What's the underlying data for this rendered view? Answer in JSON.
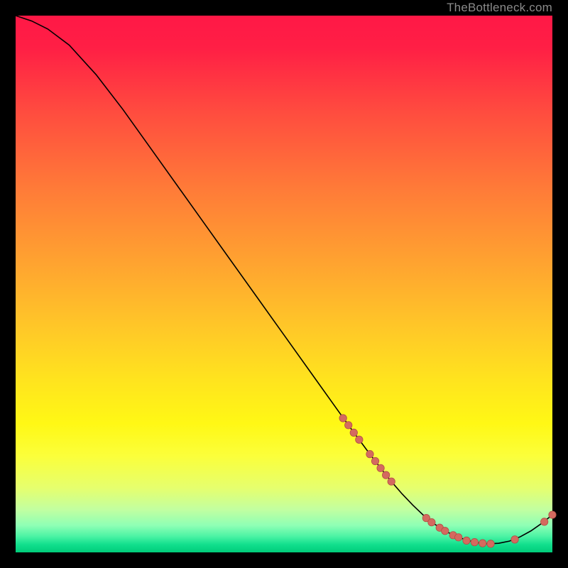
{
  "watermark": "TheBottleneck.com",
  "colors": {
    "curve_stroke": "#000000",
    "marker_fill": "#d46a5f",
    "marker_stroke": "#b24f45"
  },
  "chart_data": {
    "type": "line",
    "title": "",
    "xlabel": "",
    "ylabel": "",
    "xlim": [
      0,
      100
    ],
    "ylim": [
      0,
      100
    ],
    "grid": false,
    "legend": null,
    "series": [
      {
        "name": "curve",
        "x": [
          0,
          3,
          6,
          10,
          15,
          20,
          25,
          30,
          35,
          40,
          45,
          50,
          55,
          60,
          62,
          64,
          66,
          68,
          70,
          72,
          74,
          76,
          78,
          80,
          82,
          84,
          86,
          88,
          90,
          92,
          94,
          96,
          98,
          100
        ],
        "y": [
          100,
          99,
          97.5,
          94.5,
          89,
          82.5,
          75.5,
          68.5,
          61.5,
          54.5,
          47.5,
          40.5,
          33.5,
          26.5,
          23.7,
          21.0,
          18.3,
          15.7,
          13.2,
          10.9,
          8.8,
          6.9,
          5.3,
          4.0,
          3.0,
          2.3,
          1.8,
          1.6,
          1.7,
          2.1,
          2.9,
          4.0,
          5.4,
          7.0
        ]
      }
    ],
    "markers": [
      {
        "x": 61.0,
        "y": 25.0
      },
      {
        "x": 62.0,
        "y": 23.7
      },
      {
        "x": 63.0,
        "y": 22.3
      },
      {
        "x": 64.0,
        "y": 21.0
      },
      {
        "x": 66.0,
        "y": 18.3
      },
      {
        "x": 67.0,
        "y": 17.0
      },
      {
        "x": 68.0,
        "y": 15.7
      },
      {
        "x": 69.0,
        "y": 14.4
      },
      {
        "x": 70.0,
        "y": 13.2
      },
      {
        "x": 76.5,
        "y": 6.4
      },
      {
        "x": 77.5,
        "y": 5.6
      },
      {
        "x": 79.0,
        "y": 4.6
      },
      {
        "x": 80.0,
        "y": 4.0
      },
      {
        "x": 81.5,
        "y": 3.2
      },
      {
        "x": 82.5,
        "y": 2.8
      },
      {
        "x": 84.0,
        "y": 2.2
      },
      {
        "x": 85.5,
        "y": 1.9
      },
      {
        "x": 87.0,
        "y": 1.7
      },
      {
        "x": 88.5,
        "y": 1.6
      },
      {
        "x": 93.0,
        "y": 2.4
      },
      {
        "x": 98.5,
        "y": 5.7
      },
      {
        "x": 100.0,
        "y": 7.0
      }
    ]
  }
}
